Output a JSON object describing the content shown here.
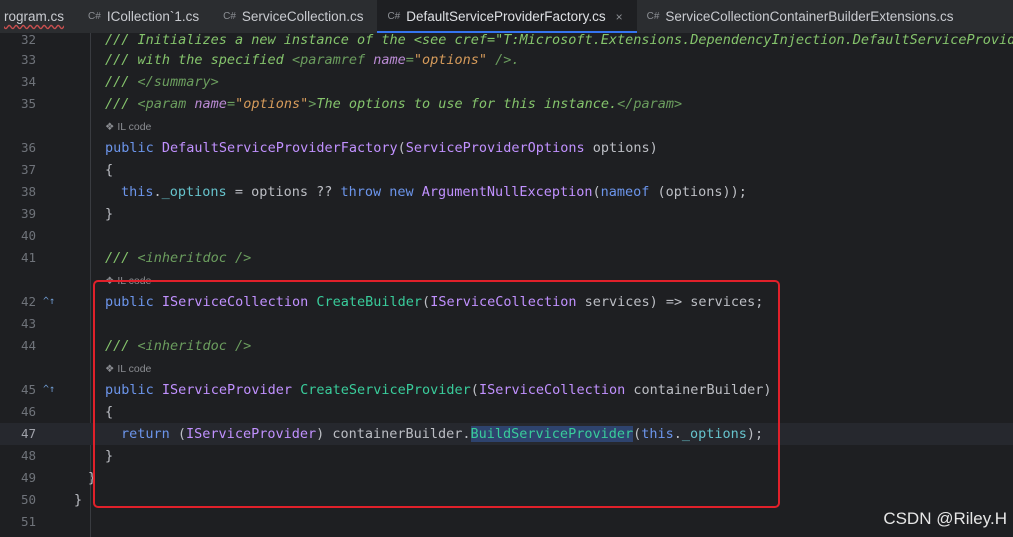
{
  "tabs": [
    {
      "lang": "",
      "label": "rogram.cs",
      "active": false
    },
    {
      "lang": "C#",
      "label": "ICollection`1.cs",
      "active": false
    },
    {
      "lang": "C#",
      "label": "ServiceCollection.cs",
      "active": false
    },
    {
      "lang": "C#",
      "label": "DefaultServiceProviderFactory.cs",
      "active": true,
      "close": "×"
    },
    {
      "lang": "C#",
      "label": "ServiceCollectionContainerBuilderExtensions.cs",
      "active": false
    }
  ],
  "lines": {
    "l32": {
      "num": "32",
      "text": "/// Initializes a new instance of the <see cref=\"T:Microsoft.Extensions.DependencyInjection.DefaultServiceProviderFac"
    },
    "l33": {
      "num": "33",
      "a": "/// with the specified ",
      "b": "<paramref ",
      "c": "name",
      "d": "=",
      "e": "\"options\"",
      "f": " />."
    },
    "l34": {
      "num": "34",
      "a": "/// ",
      "b": "</summary>"
    },
    "l35": {
      "num": "35",
      "a": "/// ",
      "b": "<param ",
      "c": "name",
      "d": "=",
      "e": "\"options\"",
      "f": ">",
      "g": "The options to use for this instance.",
      "h": "</param>"
    },
    "l36": {
      "num": "36",
      "a": "public",
      "b": " ",
      "c": "DefaultServiceProviderFactory",
      "d": "(",
      "e": "ServiceProviderOptions",
      "f": " options)"
    },
    "l37": {
      "num": "37",
      "a": "{"
    },
    "l38": {
      "num": "38",
      "a": "this",
      "b": ".",
      "c": "_options",
      "d": " = options ?? ",
      "e": "throw",
      "f": " ",
      "g": "new",
      "h": " ",
      "i": "ArgumentNullException",
      "j": "(",
      "k": "nameof",
      "l": " (options));"
    },
    "l39": {
      "num": "39",
      "a": "}"
    },
    "l40": {
      "num": "40"
    },
    "l41": {
      "num": "41",
      "a": "/// ",
      "b": "<inheritdoc />"
    },
    "l42": {
      "num": "42",
      "a": "public",
      "b": " ",
      "c": "IServiceCollection",
      "d": " ",
      "e": "CreateBuilder",
      "f": "(",
      "g": "IServiceCollection",
      "h": " services) => services;"
    },
    "l43": {
      "num": "43"
    },
    "l44": {
      "num": "44",
      "a": "/// ",
      "b": "<inheritdoc />"
    },
    "l45": {
      "num": "45",
      "a": "public",
      "b": " ",
      "c": "IServiceProvider",
      "d": " ",
      "e": "CreateServiceProvider",
      "f": "(",
      "g": "IServiceCollection",
      "h": " containerBuilder)"
    },
    "l46": {
      "num": "46",
      "a": "{"
    },
    "l47": {
      "num": "47",
      "a": "return",
      "b": " (",
      "c": "IServiceProvider",
      "d": ") containerBuilder.",
      "e": "BuildServiceProvider",
      "f": "(",
      "g": "this",
      "h": ".",
      "i": "_options",
      "j": ");"
    },
    "l48": {
      "num": "48",
      "a": "}"
    },
    "l49": {
      "num": "49",
      "a": "}"
    },
    "l50": {
      "num": "50",
      "a": "}"
    },
    "l51": {
      "num": "51"
    }
  },
  "hints": {
    "il_code": "❖ IL code"
  },
  "gutter_icons": {
    "override": "^↑"
  },
  "watermark": "CSDN @Riley.H",
  "colors": {
    "highlight_box": "#e0202a",
    "active_tab_underline": "#3574f0"
  }
}
